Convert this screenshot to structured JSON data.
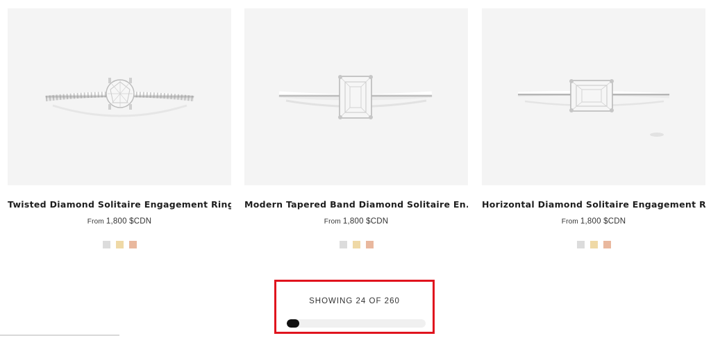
{
  "products": [
    {
      "title": "Twisted Diamond Solitaire Engagement Ring",
      "price_prefix": "From",
      "price": "1,800 $CDN",
      "swatches": [
        "#dcdcdc",
        "#efd9a6",
        "#e9b89e"
      ]
    },
    {
      "title": "Modern Tapered Band Diamond Solitaire En...",
      "price_prefix": "From",
      "price": "1,800 $CDN",
      "swatches": [
        "#dcdcdc",
        "#efd9a6",
        "#e9b89e"
      ]
    },
    {
      "title": "Horizontal Diamond Solitaire Engagement R...",
      "price_prefix": "From",
      "price": "1,800 $CDN",
      "swatches": [
        "#dcdcdc",
        "#efd9a6",
        "#e9b89e"
      ]
    }
  ],
  "pagination": {
    "showing_text": "SHOWING 24 OF 260",
    "shown": 24,
    "total": 260
  },
  "colors": {
    "highlight_border": "#e0141e",
    "progress_fill": "#111111",
    "progress_track": "#f0f0f0"
  }
}
